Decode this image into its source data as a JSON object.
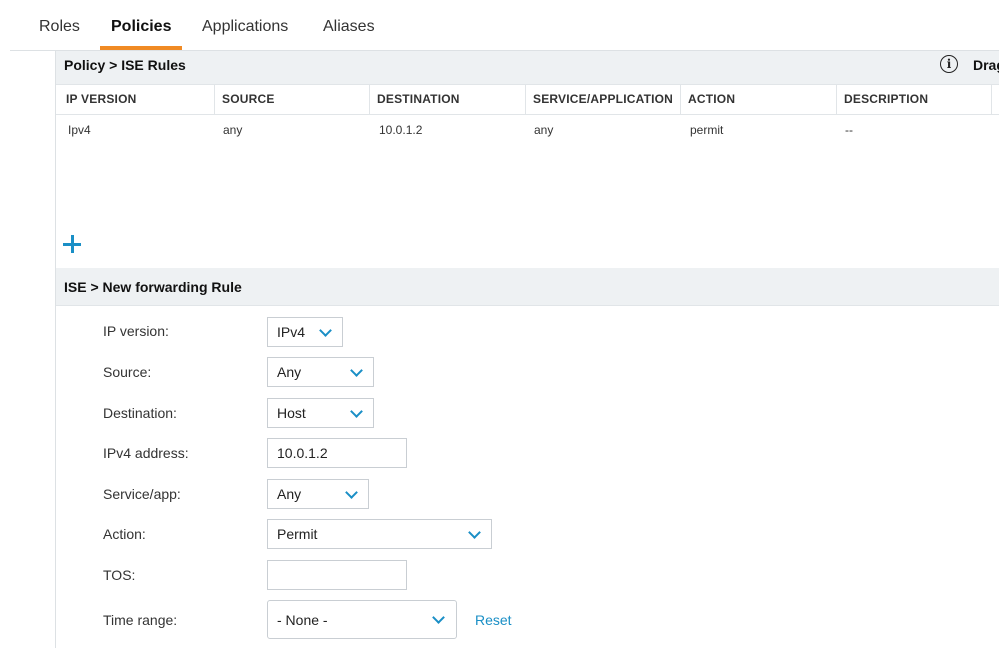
{
  "tabs": [
    {
      "label": "Roles"
    },
    {
      "label": "Policies"
    },
    {
      "label": "Applications"
    },
    {
      "label": "Aliases"
    }
  ],
  "active_tab": "Policies",
  "colors": {
    "accent": "#f08a24",
    "link": "#1a8fc6",
    "header_bg": "#eef1f3"
  },
  "rules_section": {
    "title": "Policy > ISE Rules",
    "help_icon": "info-icon",
    "side_text": "Drag"
  },
  "rules_table": {
    "columns": [
      "IP VERSION",
      "SOURCE",
      "DESTINATION",
      "SERVICE/APPLICATION",
      "ACTION",
      "DESCRIPTION"
    ],
    "rows": [
      [
        "Ipv4",
        "any",
        "10.0.1.2",
        "any",
        "permit",
        "--"
      ]
    ]
  },
  "add_rule_icon": "plus-icon",
  "form_section": {
    "title": "ISE > New forwarding Rule"
  },
  "form": {
    "ip_version": {
      "label": "IP version:",
      "value": "IPv4"
    },
    "source": {
      "label": "Source:",
      "value": "Any"
    },
    "destination": {
      "label": "Destination:",
      "value": "Host"
    },
    "ipv4_address": {
      "label": "IPv4 address:",
      "value": "10.0.1.2"
    },
    "service_app": {
      "label": "Service/app:",
      "value": "Any"
    },
    "action": {
      "label": "Action:",
      "value": "Permit"
    },
    "tos": {
      "label": "TOS:",
      "value": ""
    },
    "time_range": {
      "label": "Time range:",
      "value": "- None -",
      "reset_label": "Reset"
    }
  }
}
